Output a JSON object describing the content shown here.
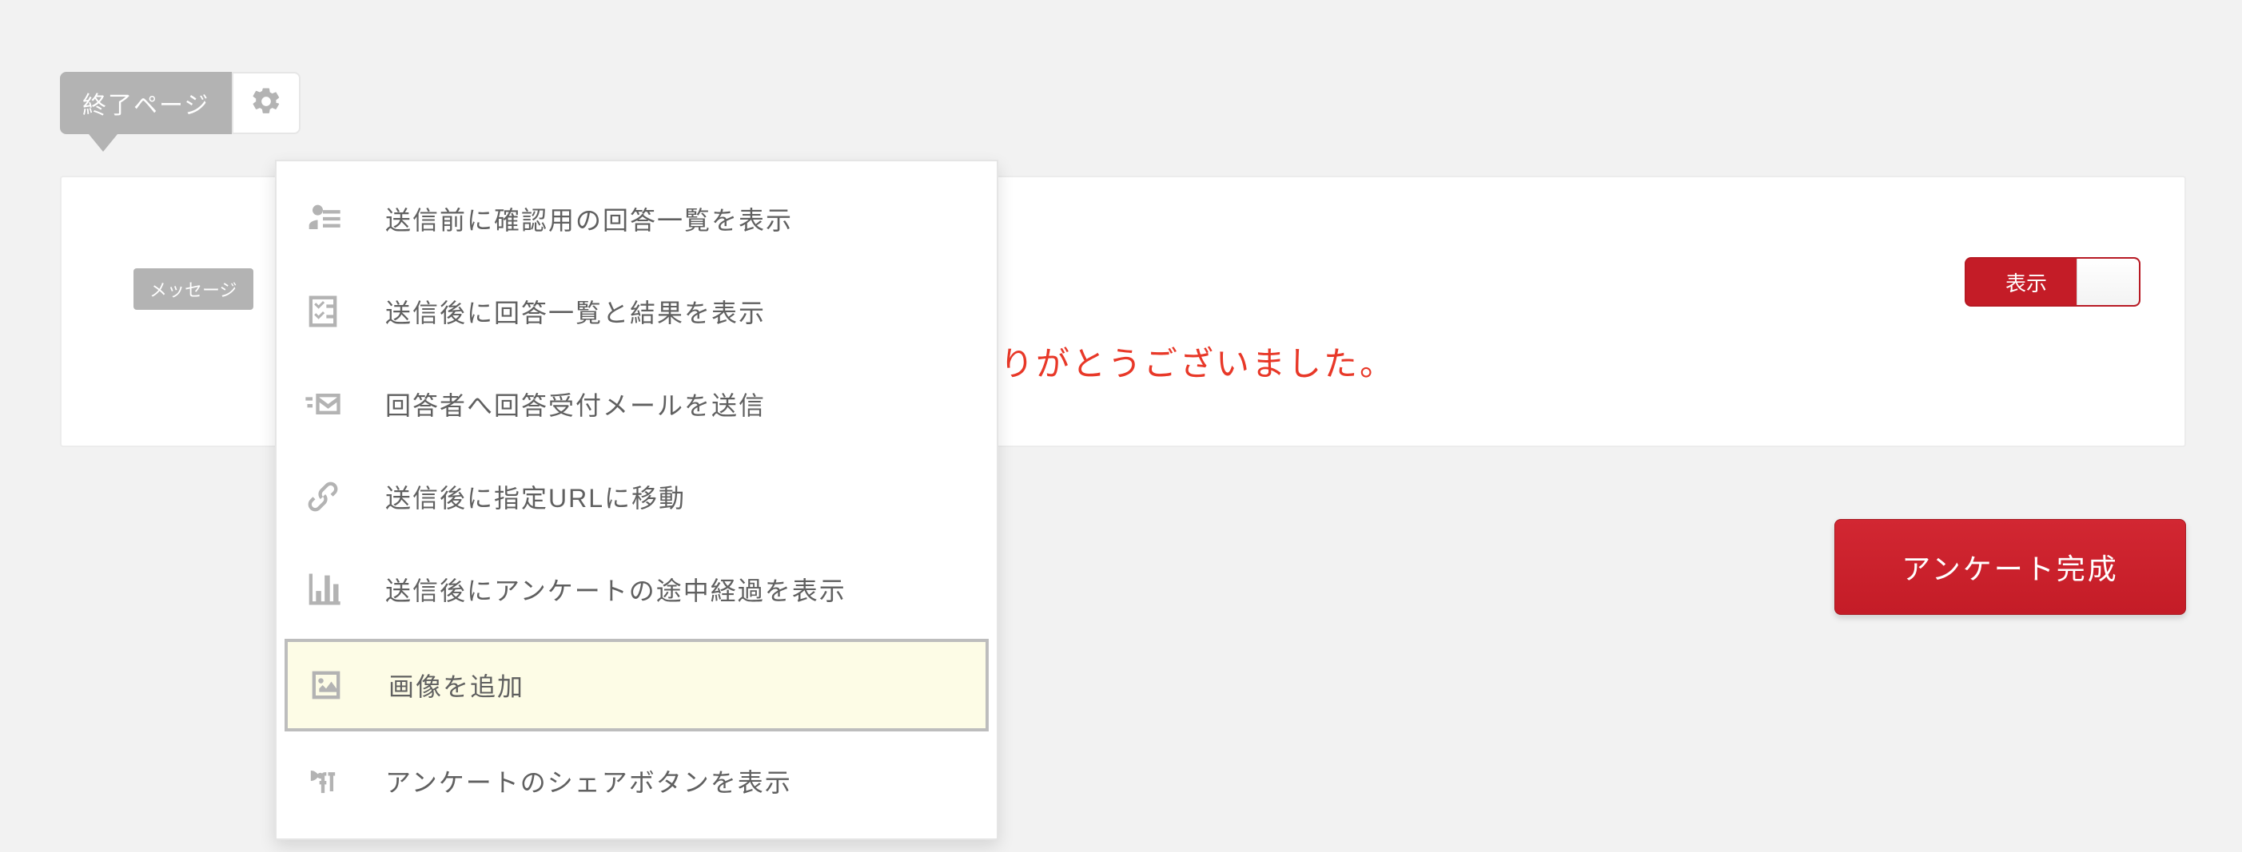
{
  "tag": {
    "label": "終了ページ"
  },
  "chip": {
    "label": "メッセージ"
  },
  "thanks_text": "りがとうございました。",
  "toggle": {
    "label": "表示"
  },
  "complete_button": "アンケート完成",
  "menu": {
    "items": [
      {
        "label": "送信前に確認用の回答一覧を表示",
        "icon": "person-list-icon"
      },
      {
        "label": "送信後に回答一覧と結果を表示",
        "icon": "list-check-icon"
      },
      {
        "label": "回答者へ回答受付メールを送信",
        "icon": "mail-send-icon"
      },
      {
        "label": "送信後に指定URLに移動",
        "icon": "link-icon"
      },
      {
        "label": "送信後にアンケートの途中経過を表示",
        "icon": "chart-icon"
      },
      {
        "label": "画像を追加",
        "icon": "image-icon"
      },
      {
        "label": "アンケートのシェアボタンを表示",
        "icon": "share-icon"
      }
    ],
    "highlight_index": 5
  }
}
